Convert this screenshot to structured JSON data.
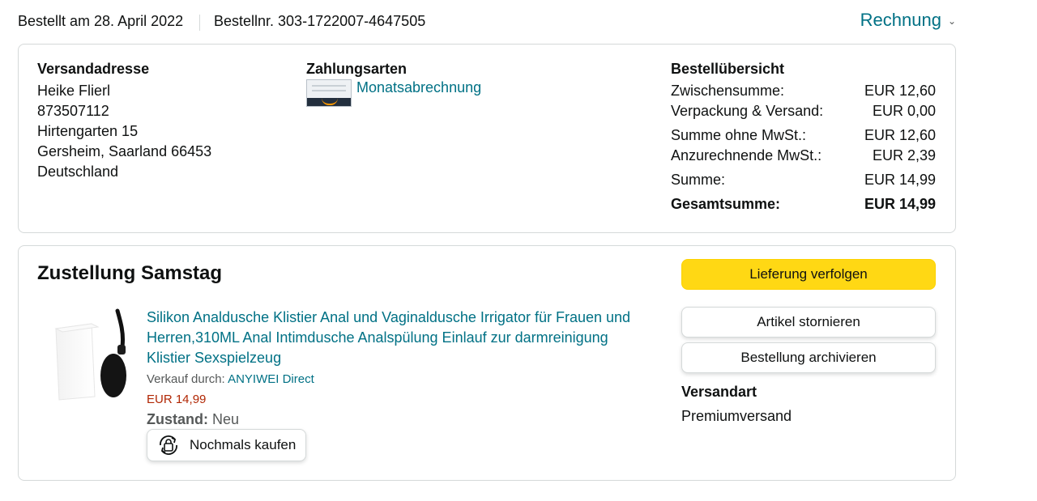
{
  "header": {
    "order_date": "Bestellt am 28. April 2022",
    "order_number": "Bestellnr. 303-1722007-4647505",
    "invoice_label": "Rechnung"
  },
  "address": {
    "heading": "Versandadresse",
    "lines": [
      "Heike Flierl",
      "873507112",
      "Hirtengarten 15",
      "Gersheim, Saarland 66453",
      "Deutschland"
    ]
  },
  "payment": {
    "heading": "Zahlungsarten",
    "method": "Monatsabrechnung",
    "icon": "amazon-card-icon"
  },
  "summary": {
    "heading": "Bestellübersicht",
    "rows": [
      {
        "label": "Zwischensumme:",
        "value": "EUR 12,60"
      },
      {
        "label": "Verpackung & Versand:",
        "value": "EUR 0,00"
      },
      {
        "label": "Summe ohne MwSt.:",
        "value": "EUR 12,60"
      },
      {
        "label": "Anzurechnende MwSt.:",
        "value": "EUR 2,39"
      },
      {
        "label": "Summe:",
        "value": "EUR 14,99"
      },
      {
        "label": "Gesamtsumme:",
        "value": "EUR 14,99"
      }
    ]
  },
  "delivery": {
    "title": "Zustellung Samstag",
    "product": {
      "title": "Silikon Analdusche Klistier Anal und Vaginaldusche Irrigator für Frauen und Herren,310ML Anal Intimdusche Analspülung Einlauf zur darmreinigung Klistier Sexspielzeug",
      "seller_prefix": "Verkauf durch:",
      "seller": "ANYIWEI Direct",
      "price": "EUR 14,99",
      "condition_label": "Zustand:",
      "condition_value": "Neu",
      "rebuy_label": "Nochmals kaufen"
    },
    "buttons": {
      "track": "Lieferung verfolgen",
      "cancel": "Artikel stornieren",
      "archive": "Bestellung archivieren"
    },
    "shipping_heading": "Versandart",
    "shipping_value": "Premiumversand"
  },
  "colors": {
    "link": "#007185",
    "price": "#B12704",
    "primary_button": "#FFD814",
    "border": "#D5D9D9"
  }
}
